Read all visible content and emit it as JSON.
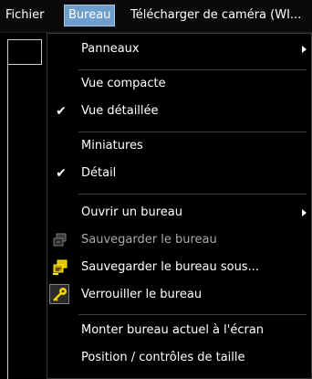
{
  "menubar": {
    "items": [
      {
        "label": "Fichier"
      },
      {
        "label": "Bureau"
      },
      {
        "label": "Télécharger de caméra (WI..."
      }
    ]
  },
  "dropdown": {
    "items": [
      {
        "label": "Panneaux",
        "submenu": true
      },
      {
        "label": "Vue compacte"
      },
      {
        "label": "Vue détaillée",
        "checked": true
      },
      {
        "label": "Miniatures"
      },
      {
        "label": "Détail",
        "checked": true
      },
      {
        "label": "Ouvrir un bureau",
        "submenu": true
      },
      {
        "label": "Sauvegarder le bureau",
        "disabled": true,
        "icon": "save-desktop-icon"
      },
      {
        "label": "Sauvegarder le bureau sous...",
        "icon": "save-desktop-as-icon"
      },
      {
        "label": "Verrouiller le bureau",
        "icon": "key-icon"
      },
      {
        "label": "Monter bureau actuel à l'écran"
      },
      {
        "label": "Position / contrôles de taille"
      }
    ],
    "check_glyph": "✔"
  },
  "colors": {
    "menubar_active": "#6e9ecb",
    "key_icon": "#f5d400",
    "text": "#ffffff",
    "disabled_text": "#a9a9a9"
  }
}
